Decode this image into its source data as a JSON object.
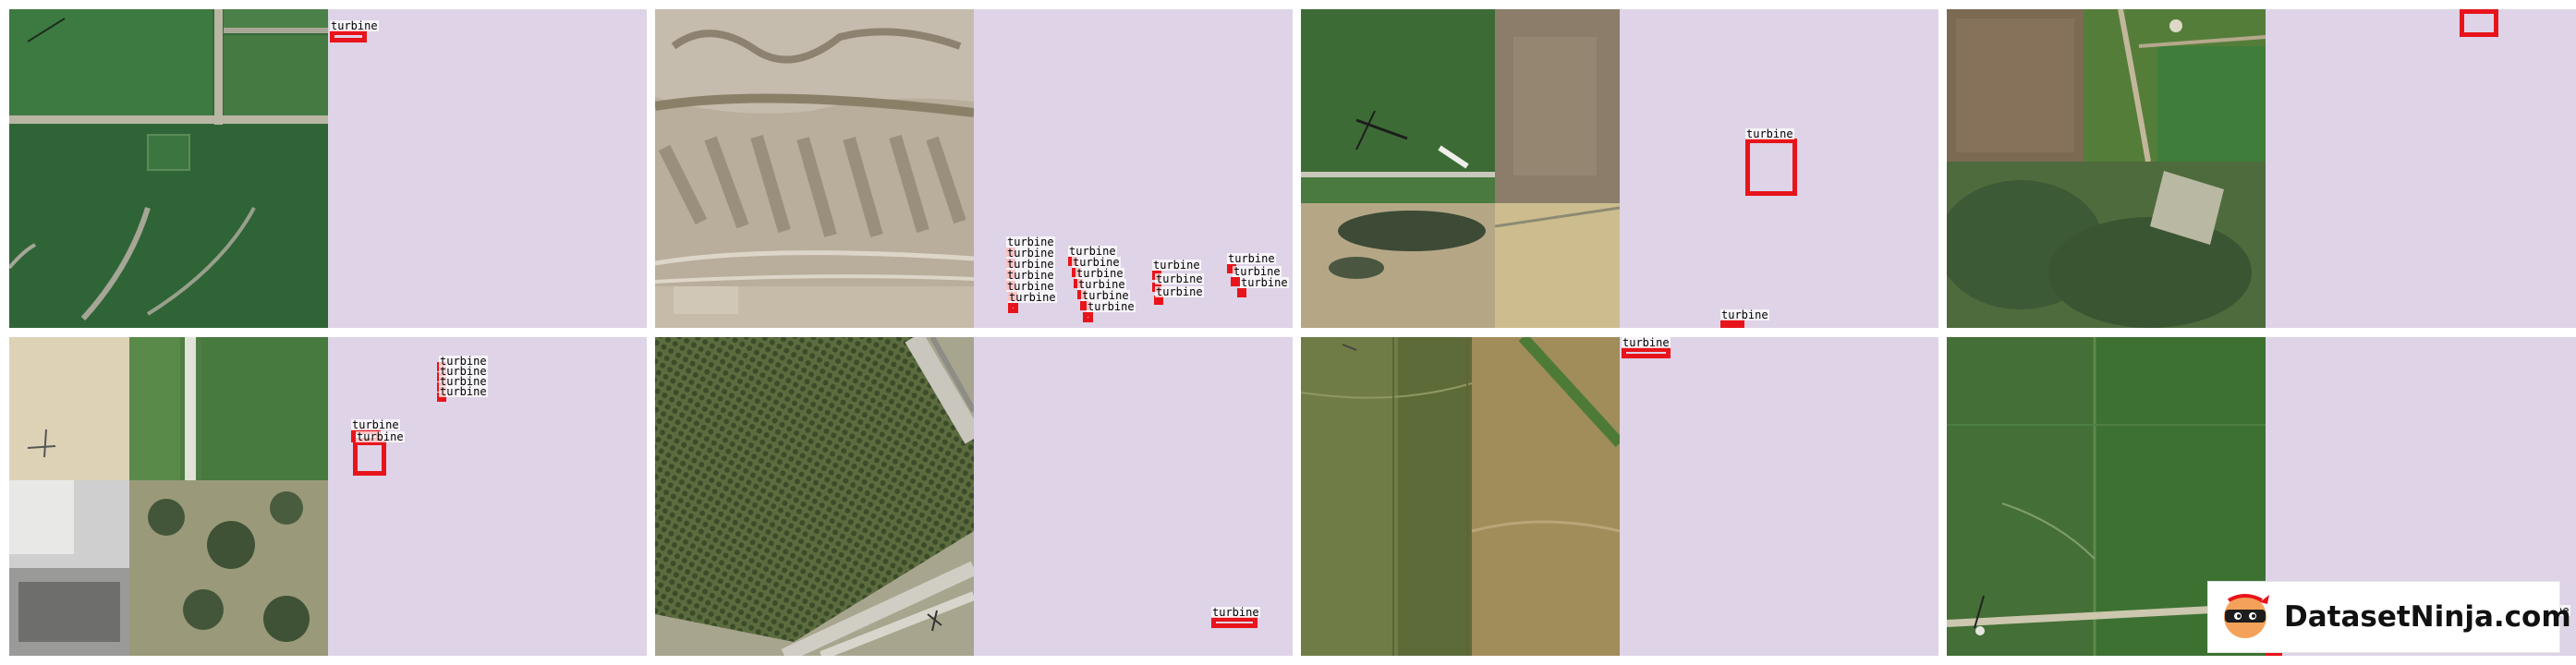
{
  "dataset": {
    "category_label": "turbine",
    "annotation_color": "#e8141b",
    "overlay_color": "#ded3e7"
  },
  "watermark": {
    "brand": "DatasetNinja.com",
    "icon": "ninja-mascot-icon"
  },
  "panels": [
    {
      "id": 1,
      "image": "farmland-crossroads",
      "annotations": 1
    },
    {
      "id": 2,
      "image": "desert-ridges",
      "annotations": 27
    },
    {
      "id": 3,
      "image": "mosaic-four-tiles",
      "annotations": 2
    },
    {
      "id": 4,
      "image": "mosaic-four-tiles",
      "annotations": 2
    },
    {
      "id": 5,
      "image": "mosaic-four-tiles",
      "annotations": 8
    },
    {
      "id": 6,
      "image": "orchard-runway",
      "annotations": 1
    },
    {
      "id": 7,
      "image": "striped-fields",
      "annotations": 1
    },
    {
      "id": 8,
      "image": "green-fields",
      "annotations": 2
    }
  ]
}
